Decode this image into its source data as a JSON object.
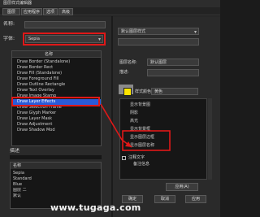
{
  "window": {
    "title": "图层样式编辑器"
  },
  "tabs": [
    {
      "label": "图层"
    },
    {
      "label": "应用程序"
    },
    {
      "label": "选项"
    },
    {
      "label": "高级"
    }
  ],
  "left": {
    "row1_label": "名称:",
    "row2_label": "字体:",
    "font_select_value": "Sepia",
    "list_header": "名称",
    "list_items": [
      "Draw Border (Standalone)",
      "Draw Border Rect",
      "Draw Fill (Standalone)",
      "Draw Foreground Fill",
      "Draw Outline Rectangle",
      "Draw Text Overlay",
      "Draw Image Stamp",
      "Draw Layer Effects",
      "Draw Selection Frame",
      "Draw Glyph Marker",
      "Draw Layer Mask",
      "Draw Adjustment",
      "Draw Shadow Mod"
    ],
    "selected_index": 7,
    "bottom_header": "描述",
    "bottom_list_header": "名称",
    "bottom_items": [
      "Sepia",
      "Standard",
      "Blue",
      "图层 二",
      "默认"
    ]
  },
  "right": {
    "top_select_value": "默认图层样式",
    "color_label": "样式颜色",
    "color_value": "#ffe500",
    "color_name": "黄色",
    "name_label": "图层名称:",
    "name_value": "默认图层",
    "desc_label": "描述:",
    "options": [
      "显示背景图",
      "阴影",
      "高光",
      "显示背景框",
      "显示图层边框",
      "显示图层名称"
    ],
    "annot_label": "注释文字",
    "annot_sub": "备注信息",
    "apply_button": "应用(A)"
  },
  "footer": {
    "ok": "确定",
    "cancel": "取消",
    "apply": "应用"
  },
  "watermark": "www.tugaga.com"
}
